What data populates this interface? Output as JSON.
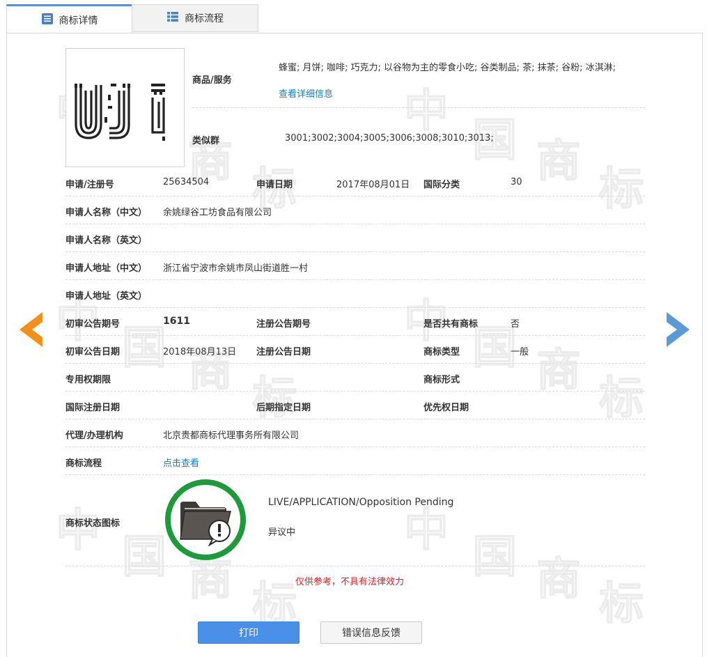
{
  "tabs": [
    {
      "label": "商标详情",
      "icon": "document-list-icon",
      "active": true
    },
    {
      "label": "商标流程",
      "icon": "grid-list-icon",
      "active": false
    }
  ],
  "logo": {
    "text": "UJi"
  },
  "goods": {
    "label": "商品/服务",
    "value": "蜂蜜; 月饼; 咖啡; 巧克力; 以谷物为主的零食小吃; 谷类制品; 茶; 抹茶; 谷粉; 冰淇淋;",
    "detail_link": "查看详细信息"
  },
  "similar_group": {
    "label": "类似群",
    "value": "3001;3002;3004;3005;3006;3008;3010;3013;"
  },
  "fields": {
    "reg_no": {
      "label": "申请/注册号",
      "value": "25634504"
    },
    "apply_date": {
      "label": "申请日期",
      "value": "2017年08月01日"
    },
    "intl_class": {
      "label": "国际分类",
      "value": "30"
    },
    "applicant_cn": {
      "label": "申请人名称（中文）",
      "value": "余姚绿谷工坊食品有限公司"
    },
    "applicant_en": {
      "label": "申请人名称（英文）",
      "value": ""
    },
    "address_cn": {
      "label": "申请人地址（中文）",
      "value": "浙江省宁波市余姚市凤山街道胜一村"
    },
    "address_en": {
      "label": "申请人地址（英文）",
      "value": ""
    },
    "prelim_no": {
      "label": "初审公告期号",
      "value": "1611"
    },
    "reg_notice_no": {
      "label": "注册公告期号",
      "value": ""
    },
    "shared": {
      "label": "是否共有商标",
      "value": "否"
    },
    "prelim_date": {
      "label": "初审公告日期",
      "value": "2018年08月13日"
    },
    "reg_notice_date": {
      "label": "注册公告日期",
      "value": ""
    },
    "tm_type": {
      "label": "商标类型",
      "value": "一般"
    },
    "exclusive_period": {
      "label": "专用权期限",
      "value": ""
    },
    "tm_form": {
      "label": "商标形式",
      "value": ""
    },
    "intl_reg_date": {
      "label": "国际注册日期",
      "value": ""
    },
    "later_designation": {
      "label": "后期指定日期",
      "value": ""
    },
    "priority_date": {
      "label": "优先权日期",
      "value": ""
    },
    "agent": {
      "label": "代理/办理机构",
      "value": "北京贵都商标代理事务所有限公司"
    },
    "process": {
      "label": "商标流程",
      "value": "点击查看"
    }
  },
  "status": {
    "label": "商标状态图标",
    "status_en": "LIVE/APPLICATION/Opposition Pending",
    "status_cn": "异议中",
    "icon": "folder-alert-icon",
    "ring_color": "#1e9a3a"
  },
  "notice": "仅供参考，不具有法律效力",
  "buttons": {
    "print": "打印",
    "feedback": "错误信息反馈"
  },
  "watermark": {
    "chars": [
      "中",
      "国",
      "商",
      "标"
    ]
  },
  "colors": {
    "link": "#1a7cc2",
    "notice": "#e02020",
    "prev_arrow": "#f39019",
    "next_arrow": "#5b9bd5",
    "print_button": "#4a90e8"
  }
}
